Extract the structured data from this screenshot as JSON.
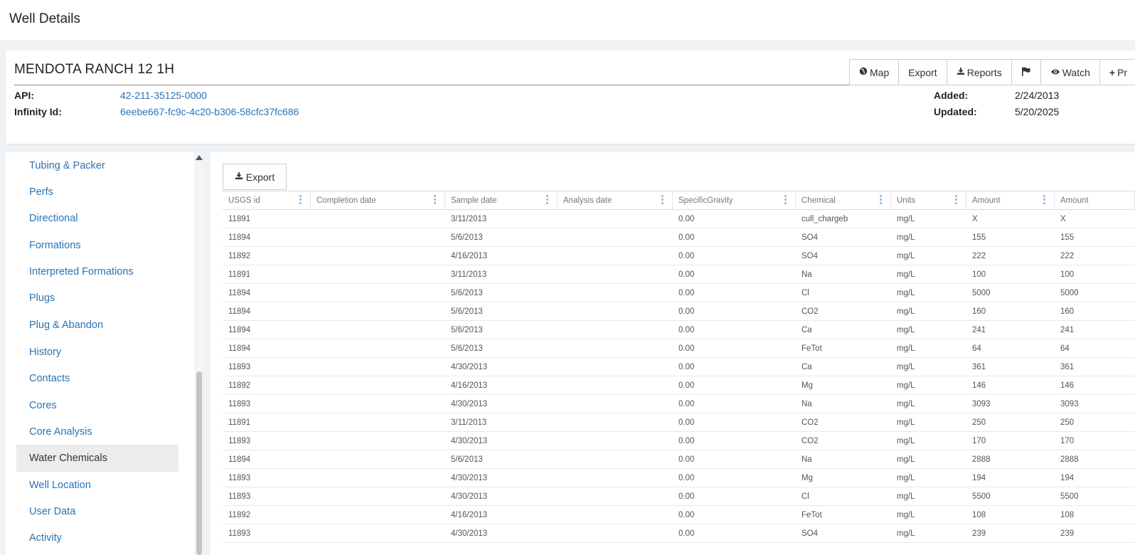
{
  "page": {
    "title": "Well Details"
  },
  "well": {
    "name": "MENDOTA RANCH 12 1H",
    "api_label": "API:",
    "api_value": "42-211-35125-0000",
    "infinity_label": "Infinity Id:",
    "infinity_value": "6eebe667-fc9c-4c20-b306-58cfc37fc686",
    "added_label": "Added:",
    "added_value": "2/24/2013",
    "updated_label": "Updated:",
    "updated_value": "5/20/2025"
  },
  "toolbar": {
    "map_label": "Map",
    "export_label": "Export",
    "reports_label": "Reports",
    "watch_label": "Watch",
    "more_label": "Pr"
  },
  "sidebar": {
    "items": [
      {
        "label": "Tubing & Packer"
      },
      {
        "label": "Perfs"
      },
      {
        "label": "Directional"
      },
      {
        "label": "Formations"
      },
      {
        "label": "Interpreted Formations"
      },
      {
        "label": "Plugs"
      },
      {
        "label": "Plug & Abandon"
      },
      {
        "label": "History"
      },
      {
        "label": "Contacts"
      },
      {
        "label": "Cores"
      },
      {
        "label": "Core Analysis"
      },
      {
        "label": "Water Chemicals"
      },
      {
        "label": "Well Location"
      },
      {
        "label": "User Data"
      },
      {
        "label": "Activity"
      }
    ],
    "active": "Water Chemicals"
  },
  "table": {
    "export_label": "Export",
    "columns": [
      "USGS id",
      "Completion date",
      "Sample date",
      "Analysis date",
      "SpecificGravity",
      "Chemical",
      "Units",
      "Amount",
      "Amount"
    ],
    "rows": [
      [
        "11891",
        "",
        "3/11/2013",
        "",
        "0.00",
        "cull_chargeb",
        "mg/L",
        "X",
        "X"
      ],
      [
        "11894",
        "",
        "5/6/2013",
        "",
        "0.00",
        "SO4",
        "mg/L",
        "155",
        "155"
      ],
      [
        "11892",
        "",
        "4/16/2013",
        "",
        "0.00",
        "SO4",
        "mg/L",
        "222",
        "222"
      ],
      [
        "11891",
        "",
        "3/11/2013",
        "",
        "0.00",
        "Na",
        "mg/L",
        "100",
        "100"
      ],
      [
        "11894",
        "",
        "5/6/2013",
        "",
        "0.00",
        "Cl",
        "mg/L",
        "5000",
        "5000"
      ],
      [
        "11894",
        "",
        "5/6/2013",
        "",
        "0.00",
        "CO2",
        "mg/L",
        "160",
        "160"
      ],
      [
        "11894",
        "",
        "5/6/2013",
        "",
        "0.00",
        "Ca",
        "mg/L",
        "241",
        "241"
      ],
      [
        "11894",
        "",
        "5/6/2013",
        "",
        "0.00",
        "FeTot",
        "mg/L",
        "64",
        "64"
      ],
      [
        "11893",
        "",
        "4/30/2013",
        "",
        "0.00",
        "Ca",
        "mg/L",
        "361",
        "361"
      ],
      [
        "11892",
        "",
        "4/16/2013",
        "",
        "0.00",
        "Mg",
        "mg/L",
        "146",
        "146"
      ],
      [
        "11893",
        "",
        "4/30/2013",
        "",
        "0.00",
        "Na",
        "mg/L",
        "3093",
        "3093"
      ],
      [
        "11891",
        "",
        "3/11/2013",
        "",
        "0.00",
        "CO2",
        "mg/L",
        "250",
        "250"
      ],
      [
        "11893",
        "",
        "4/30/2013",
        "",
        "0.00",
        "CO2",
        "mg/L",
        "170",
        "170"
      ],
      [
        "11894",
        "",
        "5/6/2013",
        "",
        "0.00",
        "Na",
        "mg/L",
        "2888",
        "2888"
      ],
      [
        "11893",
        "",
        "4/30/2013",
        "",
        "0.00",
        "Mg",
        "mg/L",
        "194",
        "194"
      ],
      [
        "11893",
        "",
        "4/30/2013",
        "",
        "0.00",
        "Cl",
        "mg/L",
        "5500",
        "5500"
      ],
      [
        "11892",
        "",
        "4/16/2013",
        "",
        "0.00",
        "FeTot",
        "mg/L",
        "108",
        "108"
      ],
      [
        "11893",
        "",
        "4/30/2013",
        "",
        "0.00",
        "SO4",
        "mg/L",
        "239",
        "239"
      ]
    ]
  }
}
